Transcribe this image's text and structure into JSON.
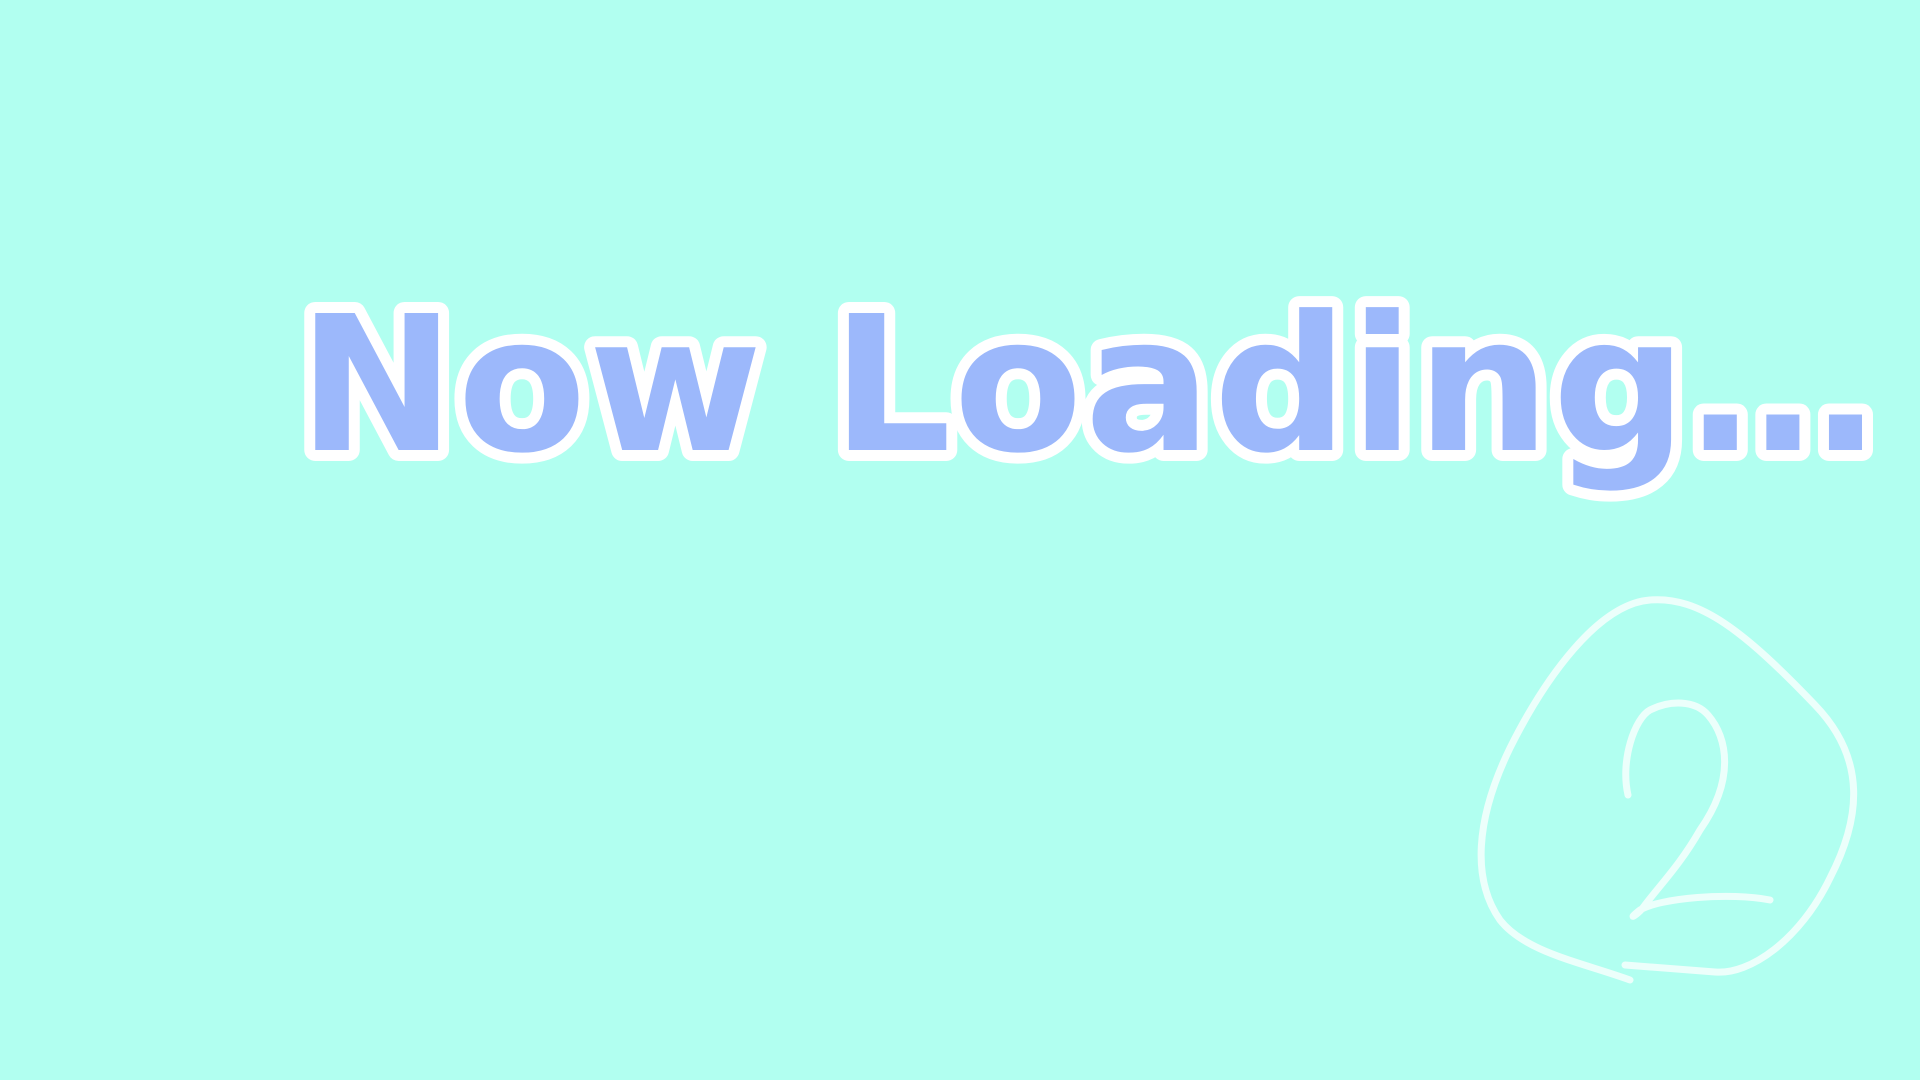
{
  "loading": {
    "text": "Now Loading…",
    "fill_color": "#9cb8fb",
    "outline_color": "#ffffff"
  },
  "background_color": "#b1fff0",
  "spinner": {
    "icon": "scribble-loading-icon",
    "color": "#ecfffb"
  }
}
